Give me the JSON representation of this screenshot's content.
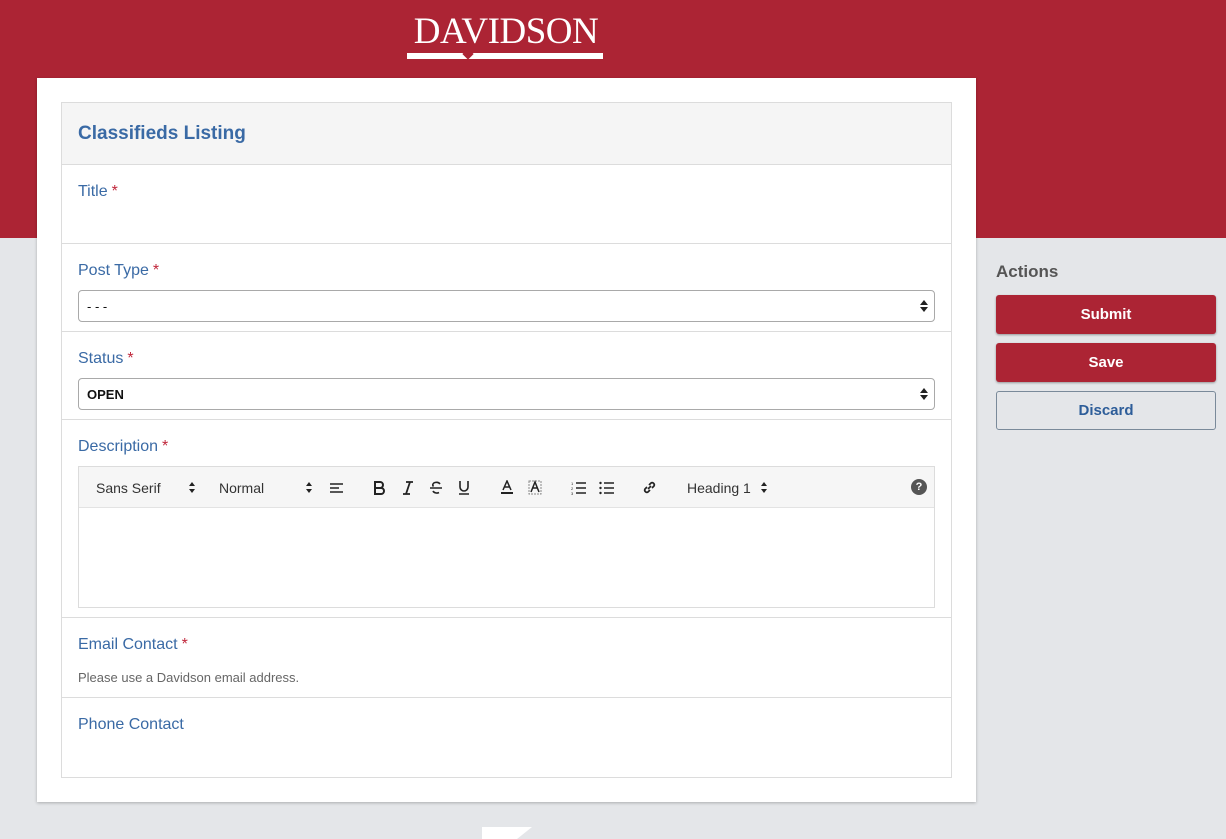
{
  "brand": {
    "name": "DAVIDSON",
    "color": "#ac2434"
  },
  "form": {
    "title": "Classifieds Listing",
    "required_marker": "*",
    "fields": {
      "title": {
        "label": "Title"
      },
      "post_type": {
        "label": "Post Type",
        "value": "- - -"
      },
      "status": {
        "label": "Status",
        "value": "OPEN"
      },
      "description": {
        "label": "Description",
        "toolbar": {
          "font": "Sans Serif",
          "size": "Normal",
          "header": "Heading 1",
          "help": "?"
        }
      },
      "email": {
        "label": "Email Contact",
        "help": "Please use a Davidson email address."
      },
      "phone": {
        "label": "Phone Contact"
      }
    }
  },
  "actions": {
    "title": "Actions",
    "submit": "Submit",
    "save": "Save",
    "discard": "Discard"
  },
  "icons": [
    "align-left-icon",
    "bold-icon",
    "italic-icon",
    "strike-icon",
    "underline-icon",
    "text-color-icon",
    "background-color-icon",
    "ordered-list-icon",
    "bullet-list-icon",
    "link-icon",
    "help-icon"
  ]
}
